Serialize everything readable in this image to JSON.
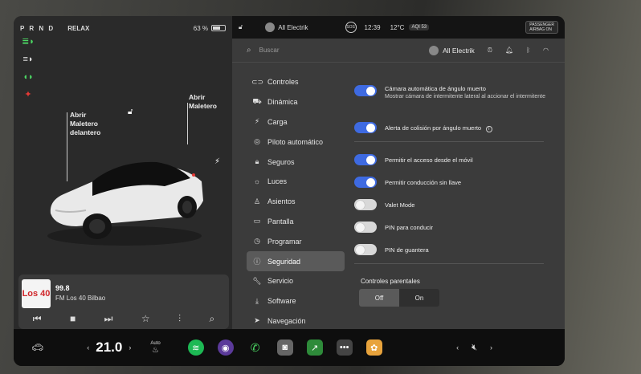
{
  "status": {
    "gear": "P R N D",
    "drive_mode": "RELAX",
    "battery_percent": "63 %",
    "battery_level": 0.63
  },
  "light_icons": [
    "headlights-icon",
    "low-beam-icon",
    "parking-lights-icon",
    "seatbelt-warning-icon"
  ],
  "car": {
    "frunk_label": "Abrir\nMaletero\ndelantero",
    "trunk_label": "Abrir\nMaletero"
  },
  "media": {
    "logo_text": "Los 40",
    "frequency": "99.8",
    "station": "FM Los 40 Bilbao",
    "controls": [
      "prev-icon",
      "stop-icon",
      "next-icon",
      "favorite-icon",
      "equalizer-icon",
      "search-icon"
    ]
  },
  "topbar": {
    "profile": "All Electrik",
    "sos": "SOS",
    "time": "12:39",
    "temperature": "12°C",
    "aqi": "AQI 53",
    "airbag_line1": "PASSENGER",
    "airbag_line2": "AIRBAG ON"
  },
  "search": {
    "placeholder": "Buscar",
    "profile": "All Electrik"
  },
  "nav": [
    {
      "label": "Controles",
      "icon": "toggle-icon"
    },
    {
      "label": "Dinámica",
      "icon": "car-icon"
    },
    {
      "label": "Carga",
      "icon": "bolt-icon"
    },
    {
      "label": "Piloto automático",
      "icon": "steering-wheel-icon"
    },
    {
      "label": "Seguros",
      "icon": "lock-icon"
    },
    {
      "label": "Luces",
      "icon": "light-icon"
    },
    {
      "label": "Asientos",
      "icon": "seat-icon"
    },
    {
      "label": "Pantalla",
      "icon": "display-icon"
    },
    {
      "label": "Programar",
      "icon": "clock-icon"
    },
    {
      "label": "Seguridad",
      "icon": "info-icon",
      "active": true
    },
    {
      "label": "Servicio",
      "icon": "wrench-icon"
    },
    {
      "label": "Software",
      "icon": "download-icon"
    },
    {
      "label": "Navegación",
      "icon": "navigation-icon"
    }
  ],
  "settings": {
    "blindspot_title": "Cámara automática de ángulo muerto",
    "blindspot_desc": "Mostrar cámara de intermitente lateral al accionar el intermitente",
    "blindspot_on": true,
    "collision_title": "Alerta de colisión por ángulo muerto",
    "collision_on": true,
    "mobile_access": "Permitir el acceso desde el móvil",
    "mobile_on": true,
    "keyless": "Permitir conducción sin llave",
    "keyless_on": true,
    "valet": "Valet Mode",
    "valet_on": false,
    "pin_drive": "PIN para conducir",
    "pin_drive_on": false,
    "pin_glovebox": "PIN de guantera",
    "pin_glovebox_on": false,
    "parental_title": "Controles parentales",
    "parental_options": [
      "Off",
      "On"
    ],
    "parental_selected": "Off"
  },
  "dock": {
    "cabin_temp": "21.0",
    "auto_label": "Auto",
    "apps": [
      "spotify-icon",
      "camera-app-icon",
      "phone-icon",
      "dashcam-icon",
      "chart-app-icon",
      "more-icon",
      "toybox-icon"
    ],
    "volume_icon": "mute-icon"
  },
  "colors": {
    "accent": "#3e6ae1",
    "panel": "#3b3b3b",
    "green": "#1db954"
  }
}
